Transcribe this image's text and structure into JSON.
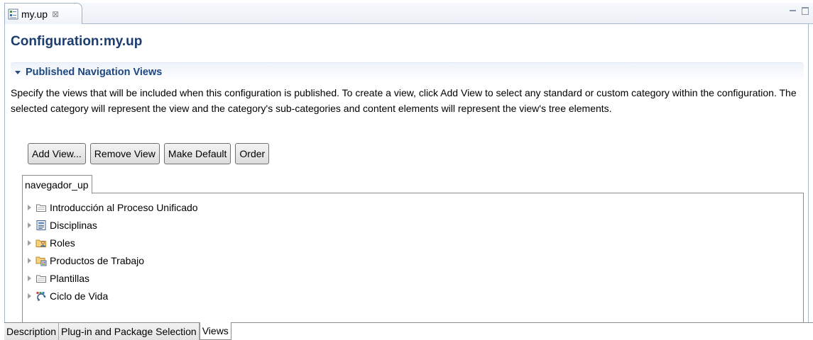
{
  "editor": {
    "tab_label": "my.up",
    "tab_close": "⊠"
  },
  "form": {
    "title": "Configuration:my.up"
  },
  "section": {
    "title": "Published Navigation Views",
    "description": "Specify the views that will be included when this configuration is published. To create a view, click Add View to select any standard or custom category within the configuration.  The selected category will represent the view and the category's sub-categories and content elements will represent the view's tree elements."
  },
  "buttons": {
    "add_view": "Add View...",
    "remove_view": "Remove View",
    "make_default": "Make Default",
    "order": "Order"
  },
  "view_tab": {
    "label": "navegador_up"
  },
  "tree": {
    "items": [
      {
        "label": "Introducción al Proceso Unificado",
        "icon": "folder-icon"
      },
      {
        "label": "Disciplinas",
        "icon": "discipline-icon"
      },
      {
        "label": "Roles",
        "icon": "roles-icon"
      },
      {
        "label": "Productos de Trabajo",
        "icon": "work-products-icon"
      },
      {
        "label": "Plantillas",
        "icon": "folder-icon"
      },
      {
        "label": "Ciclo de Vida",
        "icon": "lifecycle-icon"
      }
    ]
  },
  "bottom_tabs": [
    {
      "label": "Description",
      "active": false
    },
    {
      "label": "Plug-in and Package Selection",
      "active": false
    },
    {
      "label": "Views",
      "active": true
    }
  ],
  "colors": {
    "title": "#1c3d6e",
    "section_title": "#1c4780",
    "border": "#a9b9cf"
  }
}
